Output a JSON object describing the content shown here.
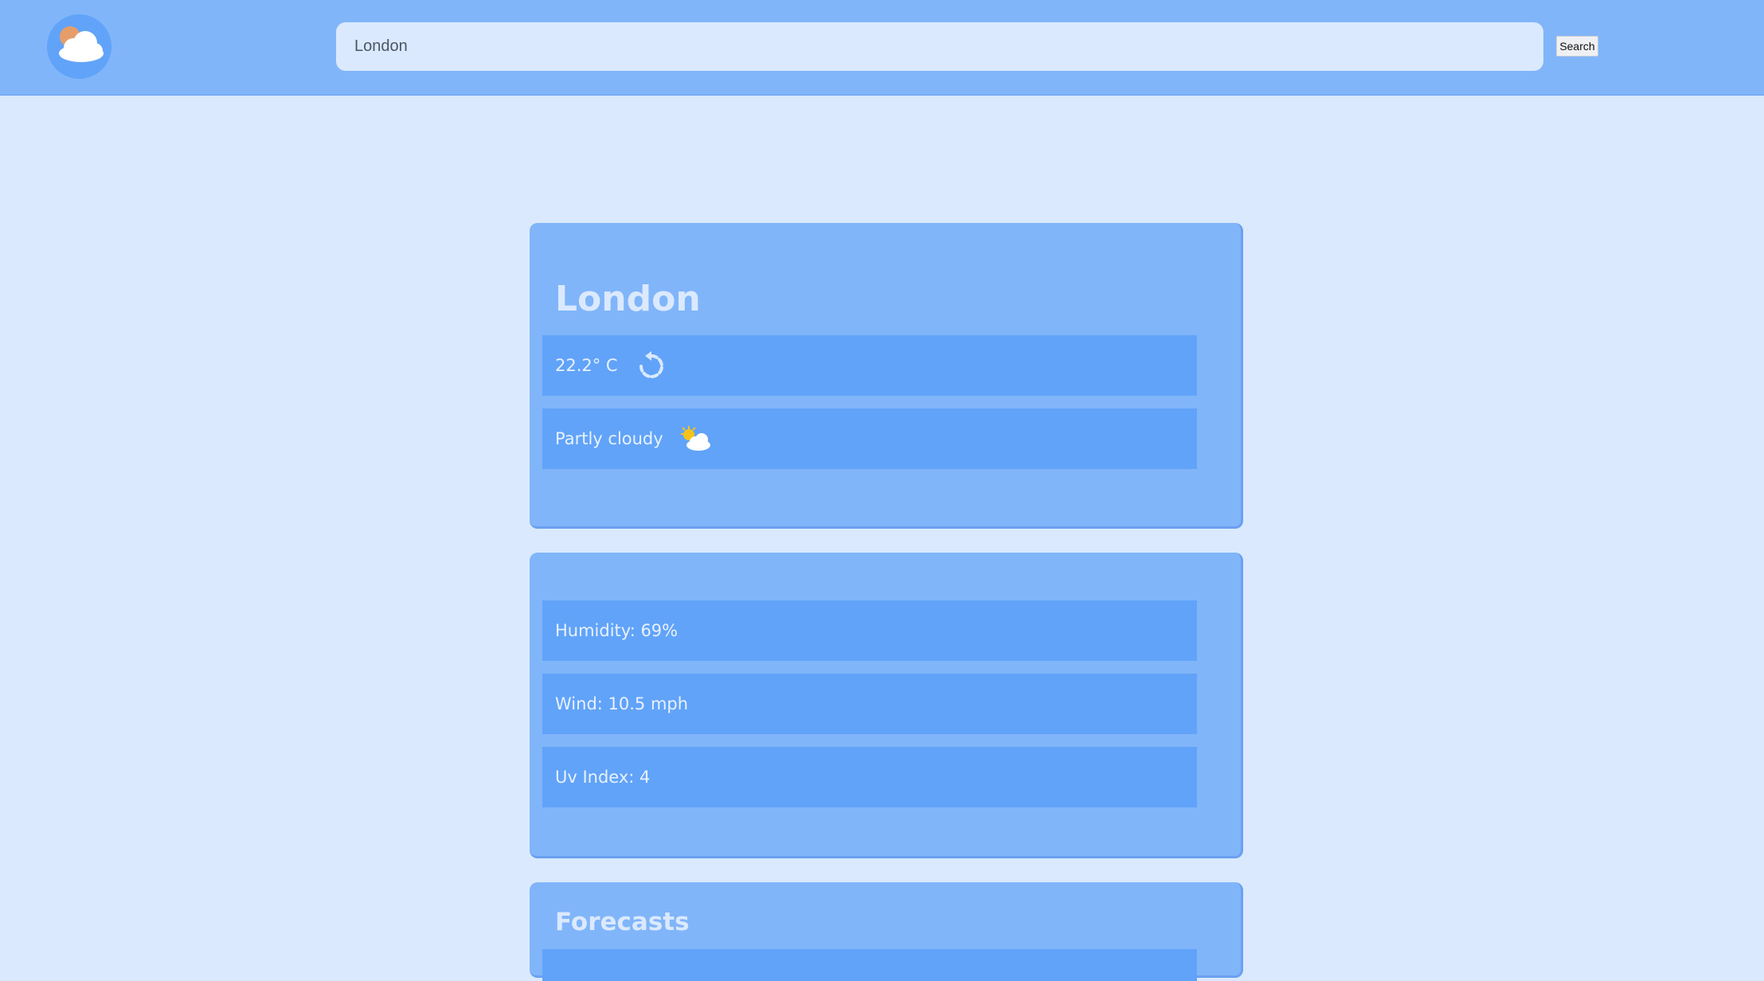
{
  "header": {
    "logo_icon": "partly-cloudy-icon",
    "search": {
      "value": "London",
      "placeholder": "",
      "button_label": "Search"
    }
  },
  "current": {
    "city": "London",
    "temperature": "22.2° C",
    "temperature_icon": "refresh-icon",
    "condition": "Partly cloudy",
    "condition_icon": "partly-cloudy-icon"
  },
  "details": {
    "humidity": "Humidity: 69%",
    "wind": "Wind: 10.5 mph",
    "uv": "Uv Index: 4"
  },
  "forecast": {
    "title": "Forecasts"
  },
  "colors": {
    "page_bg": "#dbe9fe",
    "header_bg": "#80b5fa",
    "card_bg": "#80b5fa",
    "row_bg": "#60a3f8",
    "text_light": "#e8f1ff"
  }
}
